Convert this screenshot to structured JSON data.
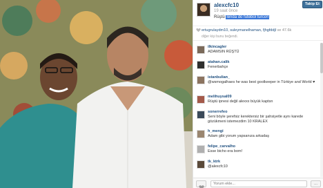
{
  "post": {
    "username": "alexcfc10",
    "time_ago": "19 saat önce",
    "caption_user": "Rüştü",
    "caption_highlight": "lenda do futebol turco!!",
    "follow_label": "Takip Et"
  },
  "likes": {
    "likers": [
      "ertugrulaydm10",
      "suleymanelhaman",
      "fjhgfddjl"
    ],
    "count_label": "ve 47.6k",
    "note": "diğer kişi bunu beğendi."
  },
  "comments": [
    {
      "user": "ilkincagler",
      "text": "ADAMSIN RÜŞTÜ",
      "avatar": "#7b6a5a"
    },
    {
      "user": "atahan.calik",
      "text": "Fenerbahçe",
      "avatar": "#2f2f2f"
    },
    {
      "user": "istanbulian_",
      "text": "@wsmogalhaes he was best goolkeeper in Türkiye and World ♥",
      "avatar": "#8c7460"
    },
    {
      "user": "melihuysal09",
      "text": "Rüştü ipnesi değil alexxx büyük kaptsn",
      "avatar": "#a45a4a"
    },
    {
      "user": "sonerrefeo",
      "text": "Seni böyle şerefsiz kerektersiz bir şahsiyetle aynı karede gözükmeni istemezdim 10 KRALEX",
      "avatar": "#3b4a5a"
    },
    {
      "user": "h_mengi",
      "text": "Adam gibi yorum yapsanıza arkadaş",
      "avatar": "#9a8670"
    },
    {
      "user": "felipe_carvalho",
      "text": "Esse bicho era bom!",
      "avatar": "#b0b0b0"
    },
    {
      "user": "tk_ktrk",
      "text": "@alexcfc10",
      "avatar": "#5a4a3a"
    }
  ],
  "footer": {
    "input_placeholder": "Yorum ekle...",
    "more_label": "..."
  }
}
